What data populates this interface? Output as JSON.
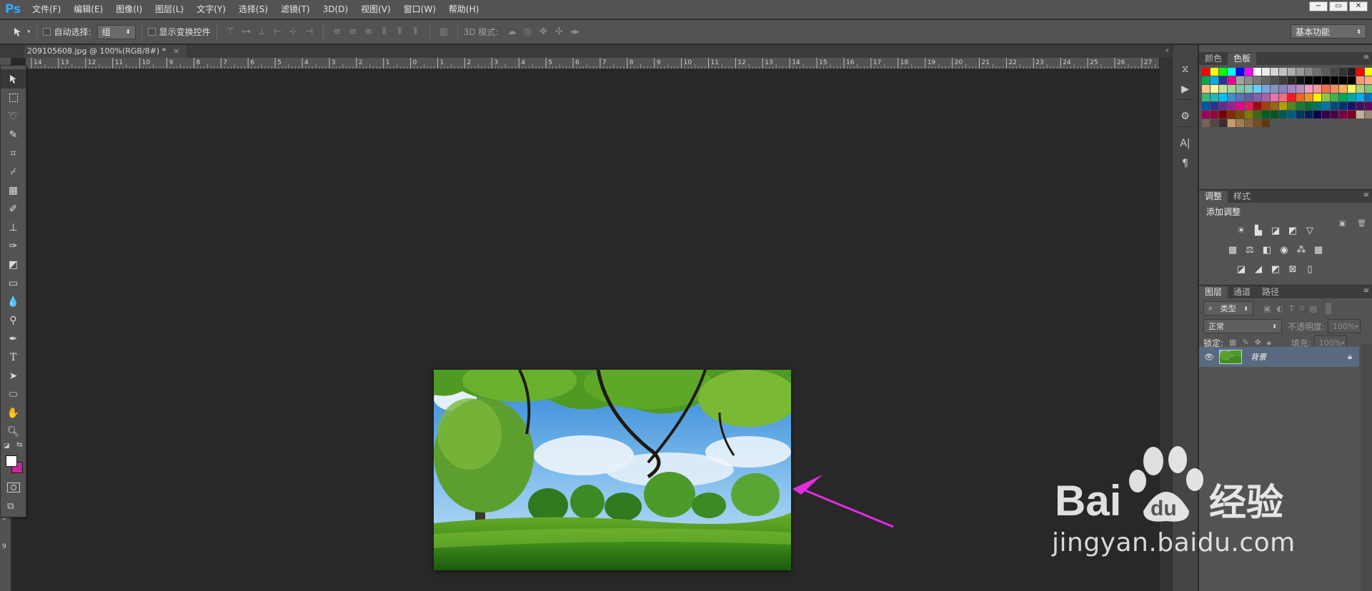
{
  "app": {
    "logo": "Ps"
  },
  "menu": [
    "文件(F)",
    "编辑(E)",
    "图像(I)",
    "图层(L)",
    "文字(Y)",
    "选择(S)",
    "滤镜(T)",
    "3D(D)",
    "视图(V)",
    "窗口(W)",
    "帮助(H)"
  ],
  "window_controls": {
    "minimize": "−",
    "restore": "▭",
    "close": "✕"
  },
  "options": {
    "auto_select_label": "自动选择:",
    "auto_select_value": "组",
    "show_transform_label": "显示变换控件",
    "mode_3d_label": "3D 模式:",
    "workspace": "基本功能"
  },
  "document": {
    "tab_title": "209105608.jpg @ 100%(RGB/8#) *",
    "close": "×"
  },
  "ruler": {
    "top_labels": [
      "14",
      "13",
      "12",
      "11",
      "10",
      "9",
      "8",
      "7",
      "6",
      "5",
      "4",
      "3",
      "2",
      "1",
      "0",
      "1",
      "2",
      "3",
      "4",
      "5",
      "6",
      "7",
      "8",
      "9",
      "10",
      "11",
      "12",
      "13",
      "14",
      "15",
      "16",
      "17",
      "18",
      "19",
      "20",
      "21",
      "22",
      "23",
      "24",
      "25",
      "26",
      "27"
    ],
    "left_labels": [
      "8",
      "9"
    ]
  },
  "panels": {
    "swatches": {
      "tabs": [
        "颜色",
        "色板"
      ],
      "active_tab": "色板"
    },
    "adjustments": {
      "tabs": [
        "调整",
        "样式"
      ],
      "active_tab": "调整",
      "title": "添加调整"
    },
    "layers": {
      "tabs": [
        "图层",
        "通道",
        "路径"
      ],
      "active_tab": "图层",
      "filter_kind": "类型",
      "blend_mode": "正常",
      "opacity_label": "不透明度:",
      "opacity_value": "100%",
      "lock_label": "锁定:",
      "fill_label": "填充:",
      "fill_value": "100%",
      "layer_name": "背景"
    }
  },
  "colors": {
    "accent_arrow": "#e32ce0",
    "layer_selected": "#596a80",
    "foreground": "#ffffff",
    "background": "#c8279a"
  },
  "watermark": {
    "brand": "Bai 经验",
    "url": "jingyan.baidu.com"
  }
}
